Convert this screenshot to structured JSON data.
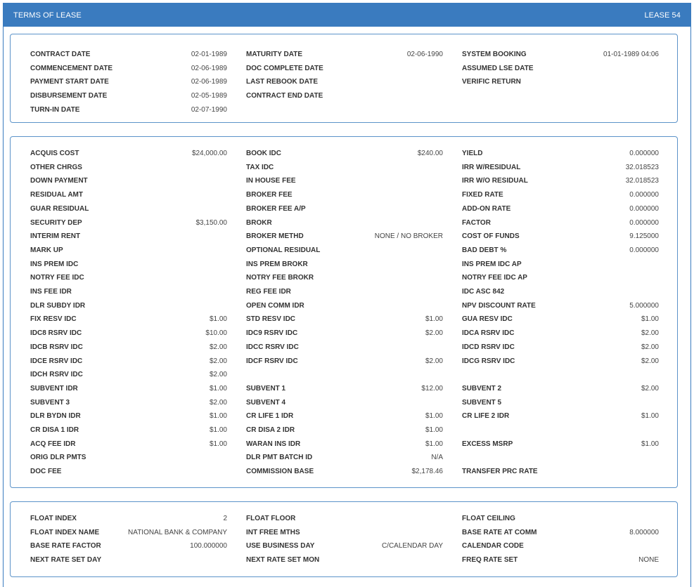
{
  "window": {
    "title": "TERMS OF LEASE",
    "lease_label": "LEASE 54"
  },
  "sections": [
    {
      "rows": [
        [
          [
            "CONTRACT DATE",
            "02-01-1989"
          ],
          [
            "MATURITY DATE",
            "02-06-1990"
          ],
          [
            "SYSTEM BOOKING",
            "01-01-1989 04:06"
          ]
        ],
        [
          [
            "COMMENCEMENT DATE",
            "02-06-1989"
          ],
          [
            "DOC COMPLETE DATE",
            ""
          ],
          [
            "ASSUMED LSE DATE",
            ""
          ]
        ],
        [
          [
            "PAYMENT START DATE",
            "02-06-1989"
          ],
          [
            "LAST REBOOK DATE",
            ""
          ],
          [
            "VERIFIC RETURN",
            ""
          ]
        ],
        [
          [
            "DISBURSEMENT DATE",
            "02-05-1989"
          ],
          [
            "CONTRACT END DATE",
            ""
          ],
          null
        ],
        [
          [
            "TURN-IN DATE",
            "02-07-1990"
          ],
          null,
          null
        ]
      ]
    },
    {
      "rows": [
        [
          [
            "ACQUIS COST",
            "$24,000.00"
          ],
          [
            "BOOK IDC",
            "$240.00"
          ],
          [
            "YIELD",
            "0.000000"
          ]
        ],
        [
          [
            "OTHER CHRGS",
            ""
          ],
          [
            "TAX IDC",
            ""
          ],
          [
            "IRR W/RESIDUAL",
            "32.018523"
          ]
        ],
        [
          [
            "DOWN PAYMENT",
            ""
          ],
          [
            "IN HOUSE FEE",
            ""
          ],
          [
            "IRR W/O RESIDUAL",
            "32.018523"
          ]
        ],
        [
          [
            "RESIDUAL AMT",
            ""
          ],
          [
            "BROKER FEE",
            ""
          ],
          [
            "FIXED RATE",
            "0.000000"
          ]
        ],
        [
          [
            "GUAR RESIDUAL",
            ""
          ],
          [
            "BROKER FEE A/P",
            ""
          ],
          [
            "ADD-ON RATE",
            "0.000000"
          ]
        ],
        [
          [
            "SECURITY DEP",
            "$3,150.00"
          ],
          [
            "BROKR",
            ""
          ],
          [
            "FACTOR",
            "0.000000"
          ]
        ],
        [
          [
            "INTERIM RENT",
            ""
          ],
          [
            "BROKER METHD",
            "NONE / NO BROKER"
          ],
          [
            "COST OF FUNDS",
            "9.125000"
          ]
        ],
        [
          [
            "MARK UP",
            ""
          ],
          [
            "OPTIONAL RESIDUAL",
            ""
          ],
          [
            "BAD DEBT %",
            "0.000000"
          ]
        ],
        [
          [
            "INS PREM IDC",
            ""
          ],
          [
            "INS PREM BROKR",
            ""
          ],
          [
            "INS PREM IDC AP",
            ""
          ]
        ],
        [
          [
            "NOTRY FEE IDC",
            ""
          ],
          [
            "NOTRY FEE BROKR",
            ""
          ],
          [
            "NOTRY FEE IDC AP",
            ""
          ]
        ],
        [
          [
            "INS FEE IDR",
            ""
          ],
          [
            "REG FEE IDR",
            ""
          ],
          [
            "IDC ASC 842",
            ""
          ]
        ],
        [
          [
            "DLR SUBDY IDR",
            ""
          ],
          [
            "OPEN COMM IDR",
            ""
          ],
          [
            "NPV DISCOUNT RATE",
            "5.000000"
          ]
        ],
        [
          [
            "FIX RESV IDC",
            "$1.00"
          ],
          [
            "STD RESV IDC",
            "$1.00"
          ],
          [
            "GUA RESV IDC",
            "$1.00"
          ]
        ],
        [
          [
            "IDC8 RSRV IDC",
            "$10.00"
          ],
          [
            "IDC9 RSRV IDC",
            "$2.00"
          ],
          [
            "IDCA RSRV IDC",
            "$2.00"
          ]
        ],
        [
          [
            "IDCB RSRV IDC",
            "$2.00"
          ],
          [
            "IDCC RSRV IDC",
            ""
          ],
          [
            "IDCD RSRV IDC",
            "$2.00"
          ]
        ],
        [
          [
            "IDCE RSRV IDC",
            "$2.00"
          ],
          [
            "IDCF RSRV IDC",
            "$2.00"
          ],
          [
            "IDCG RSRV IDC",
            "$2.00"
          ]
        ],
        [
          [
            "IDCH RSRV IDC",
            "$2.00"
          ],
          null,
          null
        ],
        [
          [
            "SUBVENT IDR",
            "$1.00"
          ],
          [
            "SUBVENT 1",
            "$12.00"
          ],
          [
            "SUBVENT 2",
            "$2.00"
          ]
        ],
        [
          [
            "SUBVENT 3",
            "$2.00"
          ],
          [
            "SUBVENT 4",
            ""
          ],
          [
            "SUBVENT 5",
            ""
          ]
        ],
        [
          [
            "DLR BYDN IDR",
            "$1.00"
          ],
          [
            "CR LIFE 1 IDR",
            "$1.00"
          ],
          [
            "CR LIFE 2 IDR",
            "$1.00"
          ]
        ],
        [
          [
            "CR DISA 1 IDR",
            "$1.00"
          ],
          [
            "CR DISA 2 IDR",
            "$1.00"
          ],
          null
        ],
        [
          [
            "ACQ FEE IDR",
            "$1.00"
          ],
          [
            "WARAN INS IDR",
            "$1.00"
          ],
          [
            "EXCESS MSRP",
            "$1.00"
          ]
        ],
        [
          [
            "ORIG DLR PMTS",
            ""
          ],
          [
            "DLR PMT BATCH ID",
            "N/A"
          ],
          null
        ],
        [
          [
            "DOC FEE",
            ""
          ],
          [
            "COMMISSION BASE",
            "$2,178.46"
          ],
          [
            "TRANSFER PRC RATE",
            ""
          ]
        ]
      ]
    },
    {
      "rows": [
        [
          [
            "FLOAT INDEX",
            "2"
          ],
          [
            "FLOAT FLOOR",
            ""
          ],
          [
            "FLOAT CEILING",
            ""
          ]
        ],
        [
          [
            "FLOAT INDEX NAME",
            "NATIONAL BANK & COMPANY"
          ],
          [
            "INT FREE MTHS",
            ""
          ],
          [
            "BASE RATE AT COMM",
            "8.000000"
          ]
        ],
        [
          [
            "BASE RATE FACTOR",
            "100.000000"
          ],
          [
            "USE BUSINESS DAY",
            "C/CALENDAR DAY"
          ],
          [
            "CALENDAR CODE",
            ""
          ]
        ],
        [
          [
            "NEXT RATE SET DAY",
            ""
          ],
          [
            "NEXT RATE SET MON",
            ""
          ],
          [
            "FREQ RATE SET",
            "NONE"
          ]
        ]
      ]
    }
  ]
}
